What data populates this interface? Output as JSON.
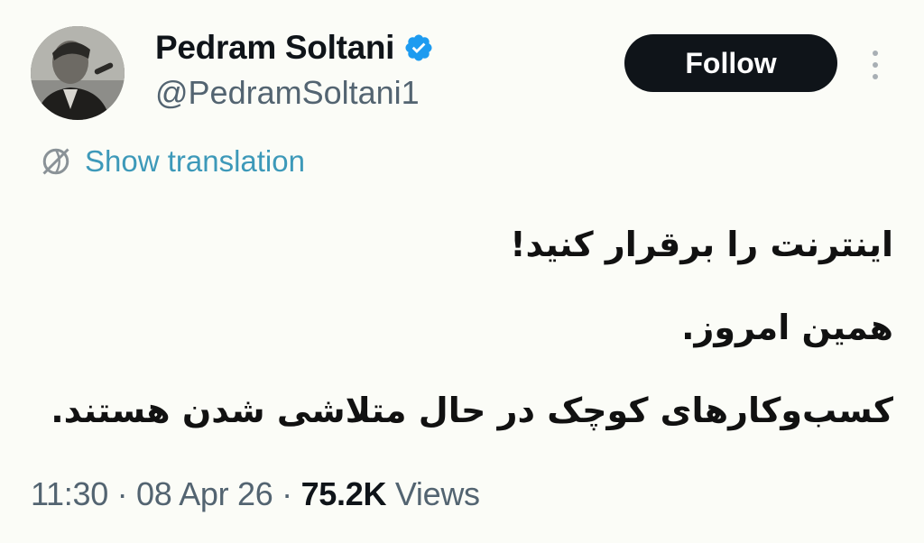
{
  "author": {
    "display_name": "Pedram Soltani",
    "handle": "@PedramSoltani1",
    "verified": true,
    "verified_color": "#1d9bf0"
  },
  "actions": {
    "follow_label": "Follow"
  },
  "translation": {
    "label": "Show translation",
    "icon": "globe-icon"
  },
  "tweet": {
    "lines": [
      "اینترنت را برقرار کنید!",
      "همین امروز.",
      "کسب‌وکارهای کوچک در حال متلاشی شدن هستند."
    ]
  },
  "meta": {
    "time": "11:30",
    "date": "08 Apr 26",
    "view_count": "75.2K",
    "views_label": "Views",
    "separator": "·"
  }
}
